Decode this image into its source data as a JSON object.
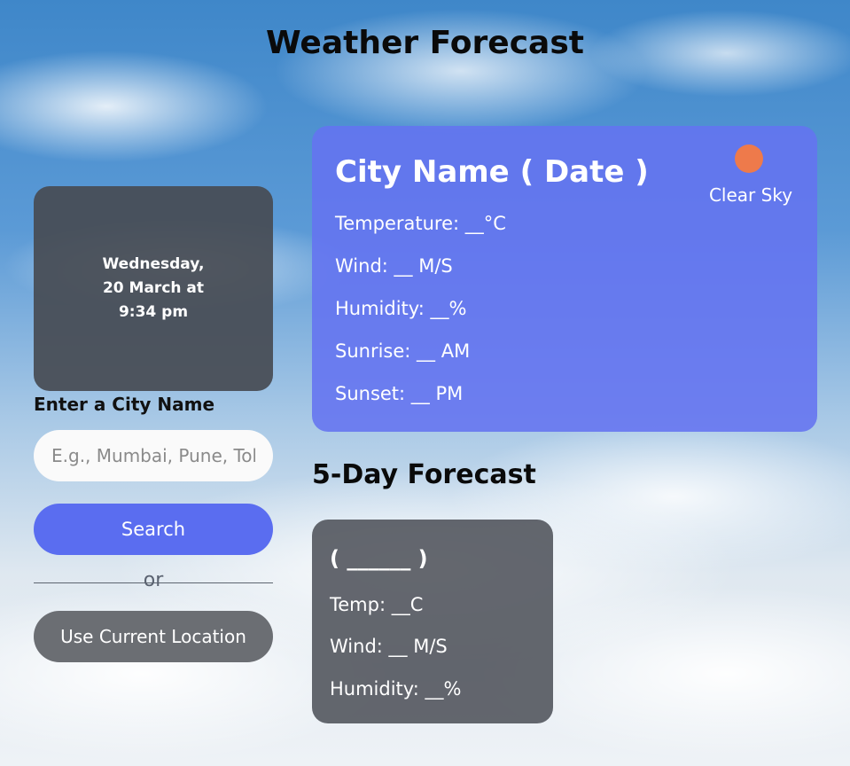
{
  "header": {
    "title": "Weather Forecast"
  },
  "sidebar": {
    "datetime_line1": "Wednesday,",
    "datetime_line2": "20 March at",
    "datetime_line3": "9:34 pm",
    "city_label": "Enter a City Name",
    "city_input": {
      "value": "",
      "placeholder": "E.g., Mumbai, Pune, Tokyo"
    },
    "search_label": "Search",
    "or_text": "or",
    "location_label": "Use Current Location"
  },
  "current": {
    "city_date": "City Name ( Date )",
    "condition": "Clear Sky",
    "icon": "sun-icon",
    "icon_color": "#ee7a4b",
    "temperature": "Temperature: __°C",
    "wind": "Wind: __ M/S",
    "humidity": "Humidity: __%",
    "sunrise": "Sunrise: __ AM",
    "sunset": "Sunset: __ PM"
  },
  "forecast": {
    "heading": "5-Day Forecast",
    "cards": [
      {
        "date": "( ______ )",
        "temp": "Temp: __C",
        "wind": "Wind: __ M/S",
        "humidity": "Humidity: __%"
      }
    ]
  },
  "colors": {
    "search_button": "#5a6df0",
    "location_button": "#6b6e73",
    "current_card": "#6473f0"
  }
}
